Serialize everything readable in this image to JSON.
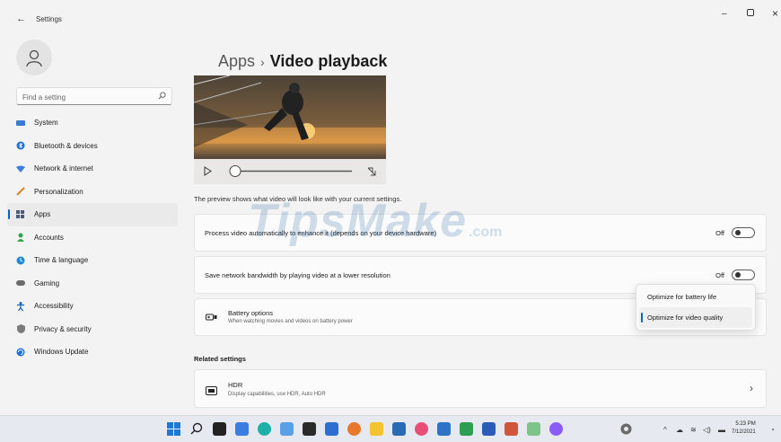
{
  "window": {
    "title": "Settings",
    "back_icon": "back-arrow-icon",
    "controls": {
      "minimize": "–",
      "maximize": "▢",
      "close": "×"
    }
  },
  "search": {
    "placeholder": "Find a setting",
    "value": ""
  },
  "nav": {
    "items": [
      {
        "label": "System",
        "icon": "system-icon",
        "color": "#3a7bd5",
        "active": false
      },
      {
        "label": "Bluetooth & devices",
        "icon": "bluetooth-icon",
        "color": "#1e6fd9",
        "active": false
      },
      {
        "label": "Network & internet",
        "icon": "network-icon",
        "color": "#3b7de0",
        "active": false
      },
      {
        "label": "Personalization",
        "icon": "brush-icon",
        "color": "#d9822b",
        "active": false
      },
      {
        "label": "Apps",
        "icon": "apps-icon",
        "color": "#4a5a78",
        "active": true
      },
      {
        "label": "Accounts",
        "icon": "accounts-icon",
        "color": "#2ea84f",
        "active": false
      },
      {
        "label": "Time & language",
        "icon": "time-language-icon",
        "color": "#1f8bd1",
        "active": false
      },
      {
        "label": "Gaming",
        "icon": "gaming-icon",
        "color": "#6b6b6b",
        "active": false
      },
      {
        "label": "Accessibility",
        "icon": "accessibility-icon",
        "color": "#1a5fb4",
        "active": false
      },
      {
        "label": "Privacy & security",
        "icon": "shield-icon",
        "color": "#7a7a7a",
        "active": false
      },
      {
        "label": "Windows Update",
        "icon": "windows-update-icon",
        "color": "#1e6fd9",
        "active": false
      }
    ]
  },
  "breadcrumb": {
    "parent": "Apps",
    "separator": "›",
    "current": "Video playback"
  },
  "preview": {
    "description": "The preview shows what video will look like with your current settings."
  },
  "settings": {
    "process_video": {
      "label": "Process video automatically to enhance it (depends on your device hardware)",
      "state": "Off"
    },
    "save_bandwidth": {
      "label": "Save network bandwidth by playing video at a lower resolution",
      "state": "Off"
    },
    "battery": {
      "title": "Battery options",
      "subtitle": "When watching movies and videos on battery power",
      "options": [
        "Optimize for battery life",
        "Optimize for video quality"
      ],
      "selected_index": 1
    }
  },
  "related": {
    "heading": "Related settings",
    "hdr": {
      "title": "HDR",
      "subtitle": "Display capabilities, use HDR, Auto HDR",
      "chevron": "›"
    }
  },
  "watermark": {
    "main": "TipsMake",
    "suffix": ".com"
  },
  "taskbar": {
    "tray_chevron": "^",
    "time": "5:23 PM",
    "date": "7/12/2021"
  }
}
